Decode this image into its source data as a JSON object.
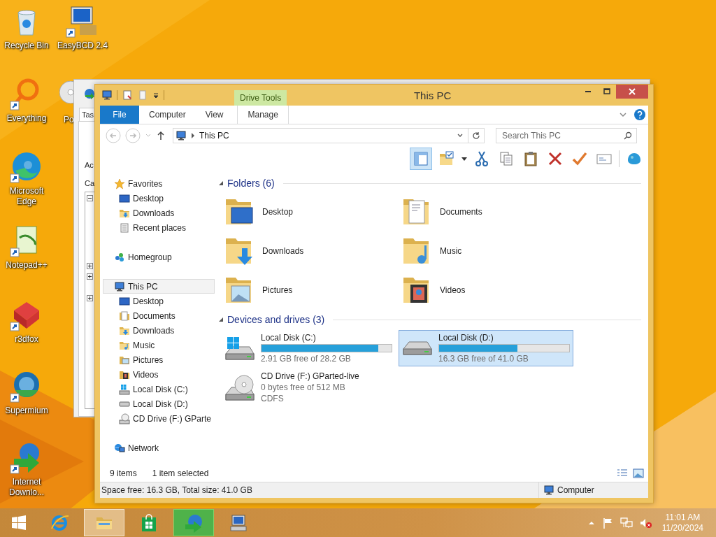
{
  "desktop_icons": [
    {
      "label": "Recycle Bin"
    },
    {
      "label": "EasyBCD 2.4"
    },
    {
      "label": "Everything"
    },
    {
      "label": "Po"
    },
    {
      "label": "Microsoft Edge"
    },
    {
      "label": "Notepad++"
    },
    {
      "label": "r3dfox"
    },
    {
      "label": "Supermium"
    },
    {
      "label": "Internet Downlo..."
    }
  ],
  "background_window": {
    "tab": "Tas",
    "labels": [
      "Ac",
      "Ca"
    ],
    "tree_nodes": [
      {
        "expanded": true
      },
      {
        "expanded": false
      },
      {
        "expanded": false
      },
      {
        "expanded": false
      }
    ]
  },
  "explorer": {
    "title": "This PC",
    "context_tab": "Drive Tools",
    "ribbon_tabs": [
      {
        "label": "File",
        "kind": "file"
      },
      {
        "label": "Computer",
        "kind": "plain"
      },
      {
        "label": "View",
        "kind": "plain"
      },
      {
        "label": "Manage",
        "kind": "contextual"
      }
    ],
    "address": "This PC",
    "search": {
      "placeholder": "Search This PC"
    },
    "toolbar": [
      {
        "on": true
      },
      {
        "on": false
      },
      {
        "on": false
      },
      {
        "on": false
      },
      {
        "on": false
      },
      {
        "on": false
      },
      {
        "on": false
      },
      {
        "on": false
      },
      {
        "on": false
      }
    ],
    "nav_pane": [
      {
        "label": "Favorites",
        "selected": false,
        "children": [
          {
            "label": "Desktop",
            "selected": false
          },
          {
            "label": "Downloads",
            "selected": false
          },
          {
            "label": "Recent places",
            "selected": false
          }
        ]
      },
      {
        "label": "Homegroup",
        "selected": false
      },
      {
        "label": "This PC",
        "selected": true,
        "children": [
          {
            "label": "Desktop",
            "selected": false
          },
          {
            "label": "Documents",
            "selected": false
          },
          {
            "label": "Downloads",
            "selected": false
          },
          {
            "label": "Music",
            "selected": false
          },
          {
            "label": "Pictures",
            "selected": false
          },
          {
            "label": "Videos",
            "selected": false
          },
          {
            "label": "Local Disk (C:)",
            "selected": false
          },
          {
            "label": "Local Disk (D:)",
            "selected": false
          },
          {
            "label": "CD Drive (F:) GParte",
            "selected": false
          }
        ]
      },
      {
        "label": "Network",
        "selected": false
      }
    ],
    "groups": [
      {
        "title": "Folders (6)",
        "expanded": true,
        "items": [
          {
            "kind": "folder",
            "label": "Desktop",
            "selected": false
          },
          {
            "kind": "folder",
            "label": "Documents",
            "selected": false
          },
          {
            "kind": "folder",
            "label": "Downloads",
            "selected": false
          },
          {
            "kind": "folder",
            "label": "Music",
            "selected": false
          },
          {
            "kind": "folder",
            "label": "Pictures",
            "selected": false
          },
          {
            "kind": "folder",
            "label": "Videos",
            "selected": false
          }
        ]
      },
      {
        "title": "Devices and drives (3)",
        "expanded": true,
        "items": [
          {
            "kind": "drive",
            "label": "Local Disk (C:)",
            "level": 0.9,
            "reading": "2.91 GB free of 28.2 GB",
            "selected": false
          },
          {
            "kind": "drive",
            "label": "Local Disk (D:)",
            "level": 0.6,
            "reading": "16.3 GB free of 41.0 GB",
            "selected": true
          },
          {
            "kind": "disc",
            "label": "CD Drive (F:) GParted-live",
            "reading": "0 bytes free of 512 MB",
            "filesystem": "CDFS",
            "selected": false
          }
        ]
      }
    ],
    "status": {
      "count": "9 items",
      "selection": "1 item selected"
    },
    "details_bar": {
      "summary": "Space free: 16.3 GB, Total size: 41.0 GB",
      "location": "Computer"
    }
  },
  "taskbar": {
    "apps": [
      {
        "selected": false,
        "hovered": false
      },
      {
        "selected": true,
        "hovered": false
      },
      {
        "selected": false,
        "hovered": false
      },
      {
        "selected": false,
        "hovered": true
      },
      {
        "selected": false,
        "hovered": false
      }
    ],
    "clock": {
      "time": "11:01 AM",
      "date": "11/20/2024"
    }
  }
}
